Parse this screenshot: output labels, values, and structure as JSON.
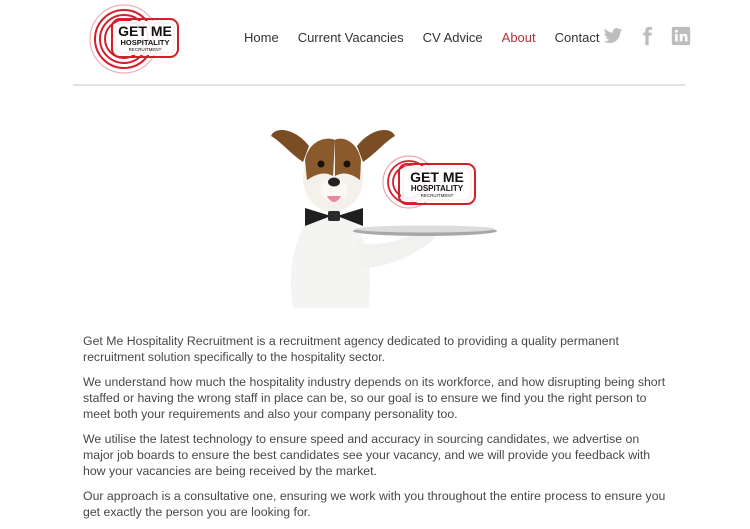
{
  "brand": {
    "logo_line1": "GET ME",
    "logo_line2": "HOSPITALITY",
    "logo_line3": "RECRUITMENT"
  },
  "nav": {
    "items": [
      {
        "label": "Home"
      },
      {
        "label": "Current Vacancies"
      },
      {
        "label": "CV Advice"
      },
      {
        "label": "About",
        "active": true
      },
      {
        "label": "Contact"
      }
    ]
  },
  "social": {
    "icons": [
      "twitter-icon",
      "facebook-icon",
      "linkedin-icon"
    ]
  },
  "colors": {
    "accent": "#b0303a",
    "logo_red": "#d21f2b",
    "social_grey": "#bdbdbd"
  },
  "body": {
    "paragraphs": [
      "Get Me Hospitality Recruitment is a recruitment agency dedicated to providing a quality permanent recruitment solution specifically to the hospitality sector.",
      "We understand how much the hospitality industry depends on its workforce, and how disrupting being short staffed or having the wrong staff in place can be, so our goal is to ensure we find you the right person to meet both your requirements and also your company personality too.",
      "We utilise the latest technology to ensure speed and accuracy in sourcing candidates, we advertise on major job boards to ensure the best candidates see your vacancy, and we will provide you feedback with how your vacancies are being received by the market.",
      "Our approach is a consultative one, ensuring we work with you throughout the entire process to ensure you get exactly the person you are looking for."
    ]
  }
}
